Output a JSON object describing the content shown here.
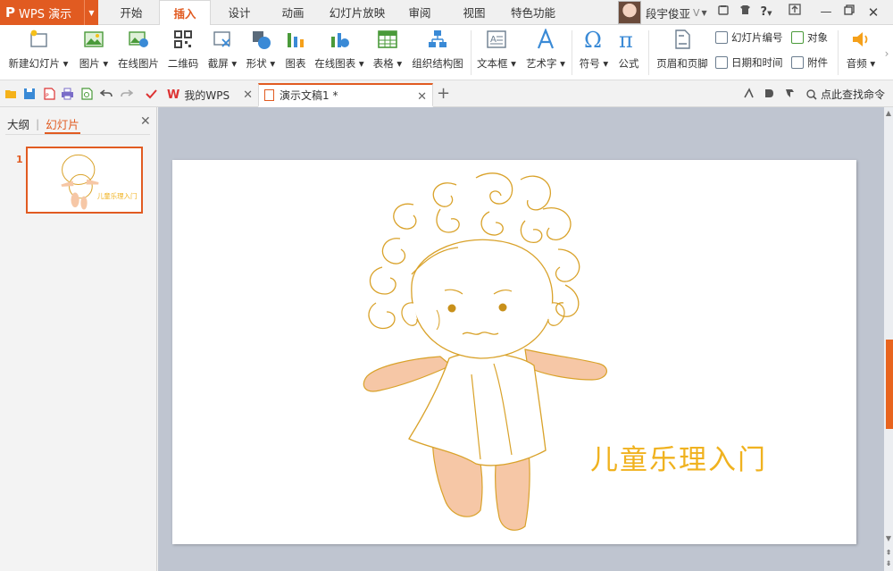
{
  "app": {
    "logo": "P",
    "name": "WPS 演示",
    "menu_tabs": [
      "开始",
      "插入",
      "设计",
      "动画",
      "幻灯片放映",
      "审阅",
      "视图",
      "特色功能"
    ],
    "active_tab": "插入",
    "user_name": "段宇俊亚",
    "user_badge": "V"
  },
  "window_controls": [
    "skin-icon",
    "shirt-icon",
    "help-icon",
    "upload-icon",
    "minimize-icon",
    "restore-icon",
    "close-icon"
  ],
  "ribbon": {
    "new_slide": "新建幻灯片",
    "picture": "图片",
    "online_picture": "在线图片",
    "qrcode": "二维码",
    "screenshot": "截屏",
    "shape": "形状",
    "chart": "图表",
    "online_chart": "在线图表",
    "table": "表格",
    "org_chart": "组织结构图",
    "textbox": "文本框",
    "wordart": "艺术字",
    "symbol": "符号",
    "formula": "公式",
    "header_footer": "页眉和页脚",
    "slide_number": "幻灯片编号",
    "date_time": "日期和时间",
    "object": "对象",
    "attachment": "附件",
    "audio": "音频"
  },
  "tabs": {
    "mywps": "我的WPS",
    "document": "演示文稿1 *"
  },
  "quick_actions": [
    "open-icon",
    "save-icon",
    "pdf-icon",
    "print-icon",
    "preview-icon",
    "undo-icon",
    "redo-icon"
  ],
  "find_command": "点此查找命令",
  "left_panel": {
    "outline_tab": "大纲",
    "slides_tab": "幻灯片",
    "slide_number": "1"
  },
  "slide": {
    "title": "儿童乐理入门"
  },
  "colors": {
    "accent": "#e15b21",
    "title_text": "#f0b21f",
    "line_art": "#d9a22a",
    "fill": "#f6c7a6"
  }
}
